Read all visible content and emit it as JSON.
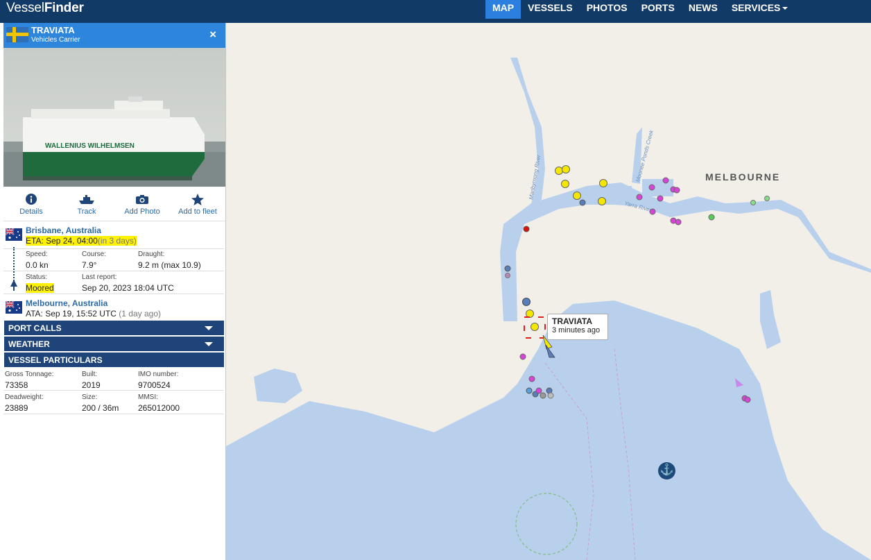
{
  "app": {
    "brand_a": "Vessel",
    "brand_b": "Finder"
  },
  "nav": [
    "MAP",
    "VESSELS",
    "PHOTOS",
    "PORTS",
    "NEWS",
    "SERVICES"
  ],
  "vessel": {
    "name": "TRAVIATA",
    "type": "Vehicles Carrier",
    "close_icon": "×"
  },
  "photo": {
    "hull_text": "WALLENIUS  WILHELMSEN"
  },
  "actions": {
    "details": "Details",
    "track": "Track",
    "add_photo": "Add Photo",
    "add_fleet": "Add to fleet"
  },
  "destination": {
    "port": "Brisbane, Australia",
    "eta": "ETA: Sep 24, 04:00",
    "eta_rel": "(in 3 days)"
  },
  "voyage": {
    "speed_label": "Speed:",
    "speed": "0.0 kn",
    "course_label": "Course:",
    "course": "7.9°",
    "draught_label": "Draught:",
    "draught": "9.2 m (max 10.9)",
    "status_label": "Status:",
    "status": "Moored",
    "report_label": "Last report:",
    "report": "Sep 20, 2023 18:04 UTC"
  },
  "departure": {
    "port": "Melbourne, Australia",
    "ata": "ATA: Sep 19, 15:52 UTC",
    "ata_rel": "(1 day ago)"
  },
  "sections": {
    "port_calls": "PORT CALLS",
    "weather": "WEATHER",
    "particulars": "VESSEL PARTICULARS"
  },
  "particulars": {
    "gt_label": "Gross Tonnage:",
    "gt": "73358",
    "built_label": "Built:",
    "built": "2019",
    "imo_label": "IMO number:",
    "imo": "9700524",
    "dwt_label": "Deadweight:",
    "dwt": "23889",
    "size_label": "Size:",
    "size": "200 / 36m",
    "mmsi_label": "MMSI:",
    "mmsi": "265012000"
  },
  "map": {
    "city": "MELBOURNE",
    "tooltip_name": "TRAVIATA",
    "tooltip_time": "3 minutes ago",
    "river_labels": [
      "Maribyrnong River",
      "Moonee Ponds Creek",
      "Yarra River"
    ],
    "anchor_icon": "⚓"
  },
  "colors": {
    "topbar": "#123a66",
    "accent": "#2b7fde",
    "panel_head": "#2e86dc",
    "section": "#1e4479",
    "water": "#b8d0ec",
    "land": "#f2efe9"
  }
}
